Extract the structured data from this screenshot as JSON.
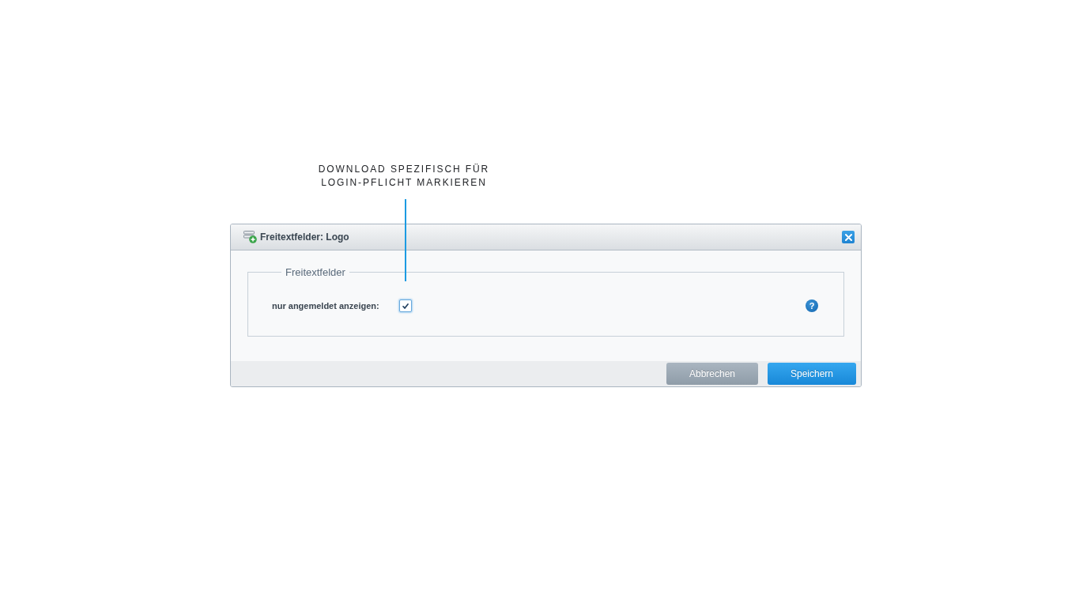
{
  "callout": {
    "text": "DOWNLOAD SPEZIFISCH FÜR\nLOGIN-PFLICHT MARKIEREN"
  },
  "dialog": {
    "title": "Freitextfelder: Logo",
    "fieldset": {
      "legend": "Freitextfelder",
      "fields": [
        {
          "kind": "checkbox",
          "label": "nur angemeldet anzeigen:",
          "checked": true,
          "help": "?"
        }
      ]
    },
    "buttons": [
      {
        "label": "Abbrechen",
        "kind": "secondary"
      },
      {
        "label": "Speichern",
        "kind": "primary"
      }
    ]
  }
}
